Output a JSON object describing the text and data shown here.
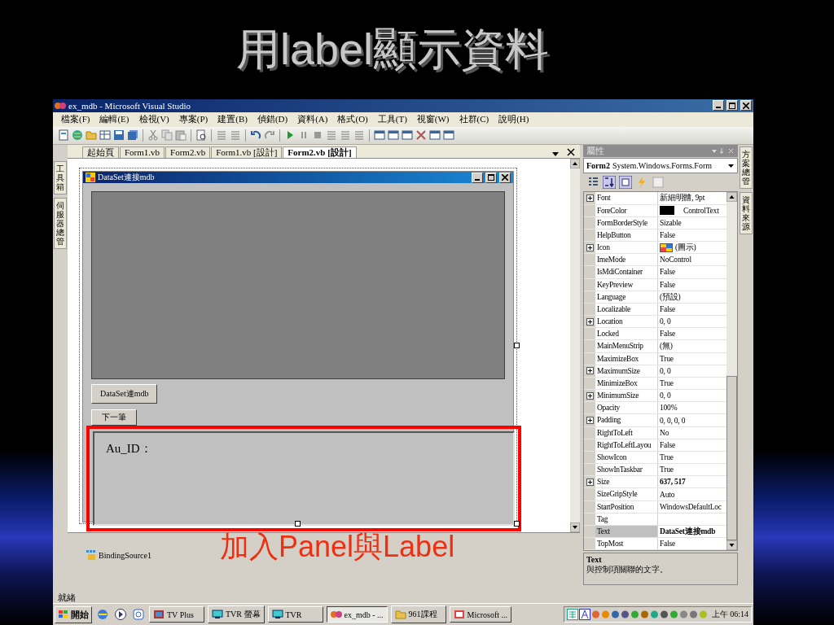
{
  "slide_title": "用label顯示資料",
  "window": {
    "title": "ex_mdb - Microsoft Visual Studio"
  },
  "menu": [
    "檔案(F)",
    "編輯(E)",
    "檢視(V)",
    "專案(P)",
    "建置(B)",
    "偵錯(D)",
    "資料(A)",
    "格式(O)",
    "工具(T)",
    "視窗(W)",
    "社群(C)",
    "說明(H)"
  ],
  "left_tabs": [
    "工具箱",
    "伺服器總管"
  ],
  "document_tabs": [
    {
      "label": "起始頁",
      "selected": false
    },
    {
      "label": "Form1.vb",
      "selected": false
    },
    {
      "label": "Form2.vb",
      "selected": false
    },
    {
      "label": "Form1.vb [設計]",
      "selected": false
    },
    {
      "label": "Form2.vb [設計]",
      "selected": true
    }
  ],
  "form": {
    "title": "DataSet連接mdb",
    "buttons": [
      "DataSet連mdb",
      "下一筆"
    ],
    "panel_label": "Au_ID："
  },
  "component_tray": [
    "BindingSource1"
  ],
  "annotation": "加入Panel與Label",
  "properties": {
    "title": "屬性",
    "object_name": "Form2",
    "object_type": "System.Windows.Forms.Form",
    "rows": [
      {
        "name": "Font",
        "value": "新細明體, 9pt",
        "kind": "text",
        "expandable": true,
        "bold": false,
        "selected": false
      },
      {
        "name": "ForeColor",
        "value": "ControlText",
        "kind": "color",
        "expandable": false,
        "bold": false,
        "selected": false
      },
      {
        "name": "FormBorderStyle",
        "value": "Sizable",
        "kind": "text",
        "expandable": false,
        "bold": false,
        "selected": false
      },
      {
        "name": "HelpButton",
        "value": "False",
        "kind": "text",
        "expandable": false,
        "bold": false,
        "selected": false
      },
      {
        "name": "Icon",
        "value": "(圖示)",
        "kind": "icon",
        "expandable": true,
        "bold": false,
        "selected": false
      },
      {
        "name": "ImeMode",
        "value": "NoControl",
        "kind": "text",
        "expandable": false,
        "bold": false,
        "selected": false
      },
      {
        "name": "IsMdiContainer",
        "value": "False",
        "kind": "text",
        "expandable": false,
        "bold": false,
        "selected": false
      },
      {
        "name": "KeyPreview",
        "value": "False",
        "kind": "text",
        "expandable": false,
        "bold": false,
        "selected": false
      },
      {
        "name": "Language",
        "value": "(預設)",
        "kind": "text",
        "expandable": false,
        "bold": false,
        "selected": false
      },
      {
        "name": "Localizable",
        "value": "False",
        "kind": "text",
        "expandable": false,
        "bold": false,
        "selected": false
      },
      {
        "name": "Location",
        "value": "0, 0",
        "kind": "text",
        "expandable": true,
        "bold": false,
        "selected": false
      },
      {
        "name": "Locked",
        "value": "False",
        "kind": "text",
        "expandable": false,
        "bold": false,
        "selected": false
      },
      {
        "name": "MainMenuStrip",
        "value": "(無)",
        "kind": "text",
        "expandable": false,
        "bold": false,
        "selected": false
      },
      {
        "name": "MaximizeBox",
        "value": "True",
        "kind": "text",
        "expandable": false,
        "bold": false,
        "selected": false
      },
      {
        "name": "MaximumSize",
        "value": "0, 0",
        "kind": "text",
        "expandable": true,
        "bold": false,
        "selected": false
      },
      {
        "name": "MinimizeBox",
        "value": "True",
        "kind": "text",
        "expandable": false,
        "bold": false,
        "selected": false
      },
      {
        "name": "MinimumSize",
        "value": "0, 0",
        "kind": "text",
        "expandable": true,
        "bold": false,
        "selected": false
      },
      {
        "name": "Opacity",
        "value": "100%",
        "kind": "text",
        "expandable": false,
        "bold": false,
        "selected": false
      },
      {
        "name": "Padding",
        "value": "0, 0, 0, 0",
        "kind": "text",
        "expandable": true,
        "bold": false,
        "selected": false
      },
      {
        "name": "RightToLeft",
        "value": "No",
        "kind": "text",
        "expandable": false,
        "bold": false,
        "selected": false
      },
      {
        "name": "RightToLeftLayou",
        "value": "False",
        "kind": "text",
        "expandable": false,
        "bold": false,
        "selected": false
      },
      {
        "name": "ShowIcon",
        "value": "True",
        "kind": "text",
        "expandable": false,
        "bold": false,
        "selected": false
      },
      {
        "name": "ShowInTaskbar",
        "value": "True",
        "kind": "text",
        "expandable": false,
        "bold": false,
        "selected": false
      },
      {
        "name": "Size",
        "value": "637, 517",
        "kind": "text",
        "expandable": true,
        "bold": true,
        "selected": false
      },
      {
        "name": "SizeGripStyle",
        "value": "Auto",
        "kind": "text",
        "expandable": false,
        "bold": false,
        "selected": false
      },
      {
        "name": "StartPosition",
        "value": "WindowsDefaultLoc",
        "kind": "text",
        "expandable": false,
        "bold": false,
        "selected": false
      },
      {
        "name": "Tag",
        "kind": "text",
        "expandable": false,
        "selected": false
      },
      {
        "name": "Text",
        "value": "DataSet連接mdb",
        "kind": "text",
        "expandable": false,
        "bold": true,
        "selected": true
      },
      {
        "name": "TopMost",
        "value": "False",
        "kind": "text",
        "expandable": false,
        "bold": false,
        "selected": false
      }
    ],
    "description_title": "Text",
    "description": "與控制項關聯的文字。"
  },
  "right_tabs": [
    "方案總管",
    "資料來源"
  ],
  "status_bar": "就緒",
  "taskbar": {
    "start": "開始",
    "tasks": [
      {
        "label": "TV Plus",
        "selected": false
      },
      {
        "label": "TVR 螢幕",
        "selected": false
      },
      {
        "label": "TVR",
        "selected": false
      },
      {
        "label": "ex_mdb - ...",
        "selected": true
      },
      {
        "label": "961課程",
        "selected": false
      },
      {
        "label": "Microsoft ...",
        "selected": false
      }
    ],
    "clock": "上午 06:14"
  }
}
